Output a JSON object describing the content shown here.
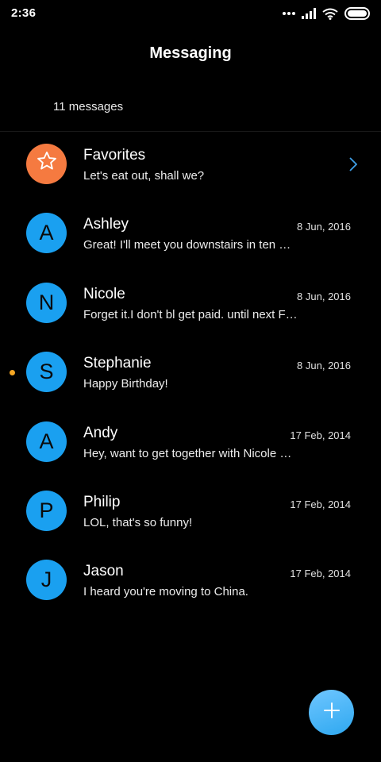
{
  "status_bar": {
    "time": "2:36",
    "icons": [
      "more-dots-icon",
      "signal-icon",
      "wifi-icon",
      "battery-icon"
    ]
  },
  "header": {
    "title": "Messaging",
    "count_text": "11 messages"
  },
  "colors": {
    "avatar_blue": "#1aa0f0",
    "favorites_orange": "#f57a40",
    "unread_dot": "#f5a623",
    "fab_blue": "#3fb2f5"
  },
  "threads": [
    {
      "name": "Favorites",
      "initial": "",
      "preview": "Let's eat out, shall we?",
      "date": "",
      "icon": "star-icon",
      "unread": false
    },
    {
      "name": "Ashley",
      "initial": "A",
      "preview": "Great! I'll meet you downstairs in ten …",
      "date": "8 Jun, 2016",
      "unread": false
    },
    {
      "name": "Nicole",
      "initial": "N",
      "preview": "Forget it.I don't bl get paid. until next F…",
      "date": "8 Jun, 2016",
      "unread": false
    },
    {
      "name": "Stephanie",
      "initial": "S",
      "preview": "Happy Birthday!",
      "date": "8 Jun, 2016",
      "unread": true
    },
    {
      "name": "Andy",
      "initial": "A",
      "preview": "Hey, want to get together with Nicole …",
      "date": "17 Feb, 2014",
      "unread": false
    },
    {
      "name": "Philip",
      "initial": "P",
      "preview": "LOL, that's so funny!",
      "date": "17 Feb, 2014",
      "unread": false
    },
    {
      "name": "Jason",
      "initial": "J",
      "preview": "I heard you're moving to China.",
      "date": "17 Feb, 2014",
      "unread": false
    }
  ],
  "fab": {
    "icon": "plus-icon"
  }
}
